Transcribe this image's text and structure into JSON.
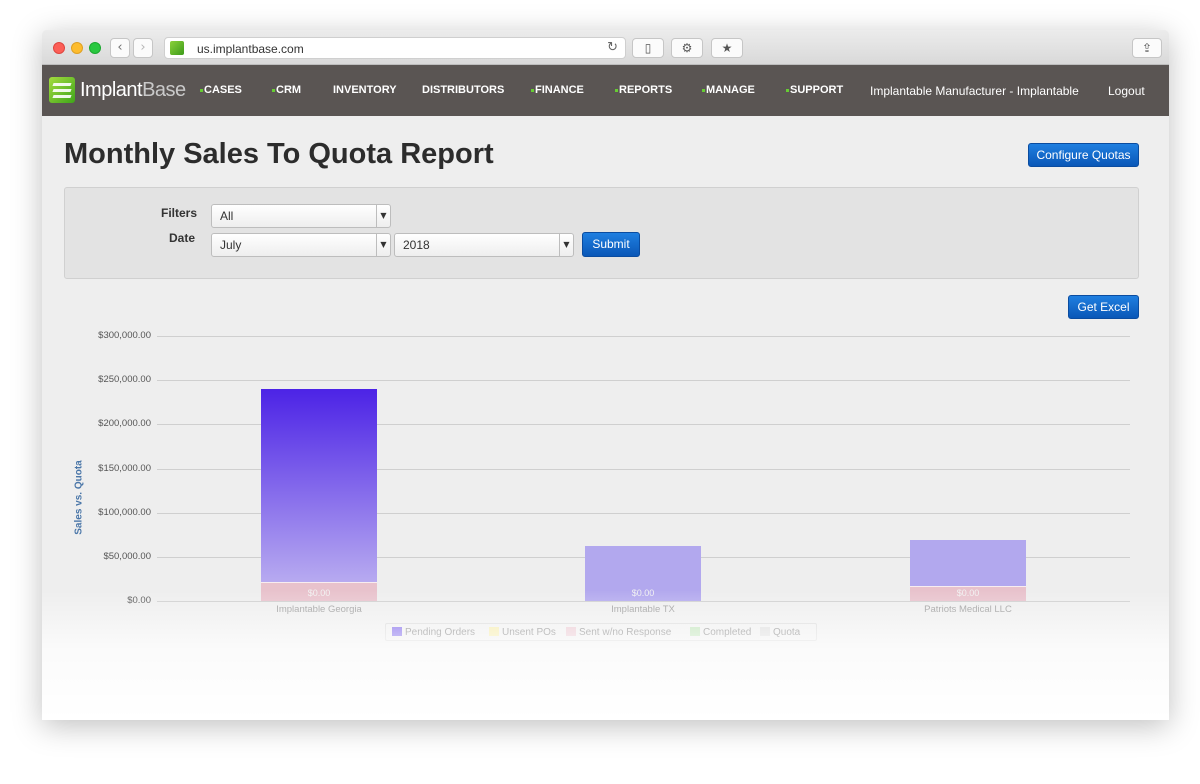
{
  "browser": {
    "url": "us.implantbase.com"
  },
  "nav": {
    "logo_main": "Implant",
    "logo_light": "Base",
    "items": [
      "CASES",
      "CRM",
      "INVENTORY",
      "DISTRIBUTORS",
      "FINANCE",
      "REPORTS",
      "MANAGE",
      "SUPPORT"
    ],
    "user": "Implantable Manufacturer - Implantable",
    "logout": "Logout"
  },
  "page": {
    "title": "Monthly Sales To Quota Report",
    "configure_button": "Configure Quotas",
    "get_excel_button": "Get Excel"
  },
  "filters": {
    "filters_label": "Filters",
    "date_label": "Date",
    "filter_value": "All",
    "month_value": "July",
    "year_value": "2018",
    "submit": "Submit"
  },
  "chart_data": {
    "type": "bar",
    "ylabel": "Sales vs. Quota",
    "ylim": [
      0,
      300000
    ],
    "yticks": [
      "$0.00",
      "$50,000.00",
      "$100,000.00",
      "$150,000.00",
      "$200,000.00",
      "$250,000.00",
      "$300,000.00"
    ],
    "categories": [
      "Implantable Georgia",
      "Implantable TX",
      "Patriots Medical LLC"
    ],
    "series": [
      {
        "name": "Pending Orders",
        "color": "#6f55e8",
        "values": [
          218000,
          62000,
          52000
        ]
      },
      {
        "name": "Unsent POs",
        "color": "#f4e9a0",
        "values": [
          0,
          0,
          0
        ]
      },
      {
        "name": "Sent w/no Response",
        "color": "#e8c2cc",
        "values": [
          22000,
          0,
          17000
        ]
      },
      {
        "name": "Completed",
        "color": "#b8e0b0",
        "values": [
          0,
          0,
          0
        ]
      },
      {
        "name": "Quota",
        "color": "#d8d8d8",
        "values": [
          0,
          0,
          0
        ]
      }
    ],
    "data_labels": [
      "$0.00",
      "$0.00",
      "$0.00"
    ],
    "legend_position": "bottom"
  }
}
